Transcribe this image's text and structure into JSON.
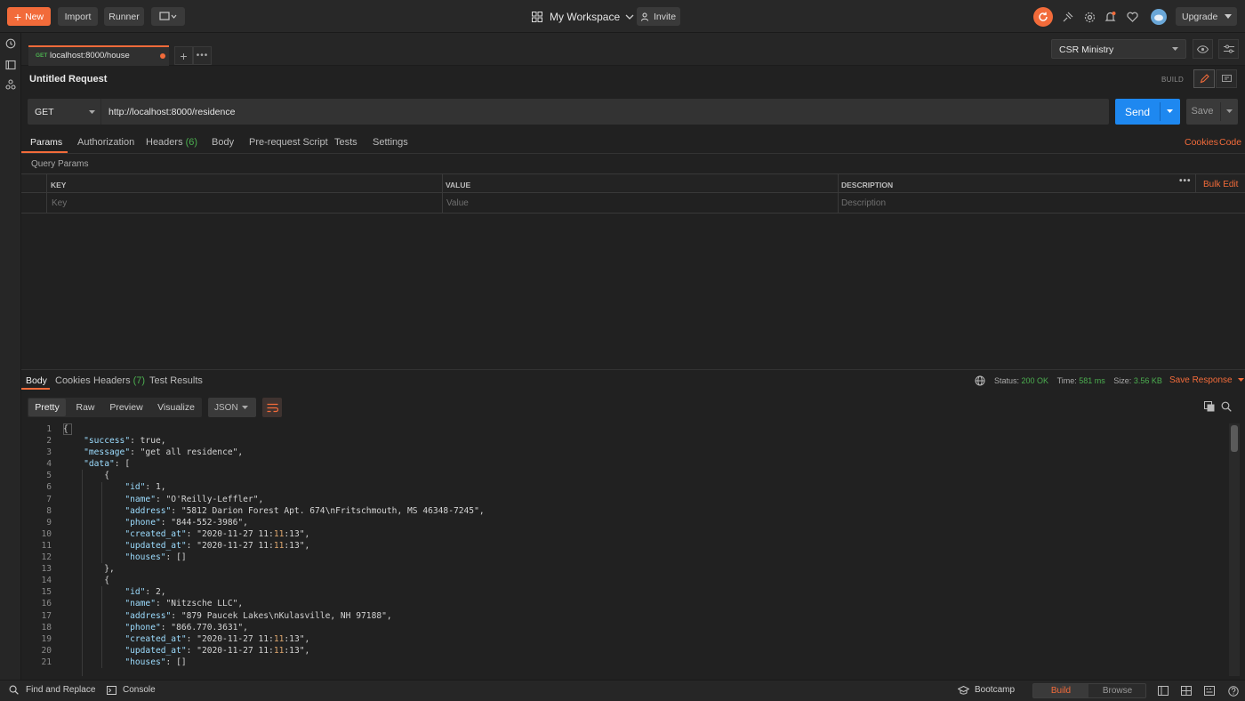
{
  "topbar": {
    "new_label": "New",
    "import_label": "Import",
    "runner_label": "Runner",
    "workspace_label": "My Workspace",
    "invite_label": "Invite",
    "upgrade_label": "Upgrade"
  },
  "tabs": {
    "active_method": "GET",
    "active_title": "localhost:8000/house"
  },
  "environment": {
    "selected": "CSR Ministry"
  },
  "request": {
    "name": "Untitled Request",
    "build_label": "BUILD",
    "method": "GET",
    "url": "http://localhost:8000/residence",
    "send_label": "Send",
    "save_label": "Save"
  },
  "request_tabs": {
    "params": "Params",
    "authorization": "Authorization",
    "headers": "Headers",
    "headers_count": "(6)",
    "body": "Body",
    "prerequest": "Pre-request Script",
    "tests": "Tests",
    "settings": "Settings",
    "cookies": "Cookies",
    "code": "Code"
  },
  "params": {
    "section_title": "Query Params",
    "col_key": "KEY",
    "col_value": "VALUE",
    "col_description": "DESCRIPTION",
    "bulk_edit": "Bulk Edit",
    "ph_key": "Key",
    "ph_value": "Value",
    "ph_description": "Description"
  },
  "response_tabs": {
    "body": "Body",
    "cookies": "Cookies",
    "headers": "Headers",
    "headers_count": "(7)",
    "test_results": "Test Results"
  },
  "response_status": {
    "status_label": "Status:",
    "status_value": "200 OK",
    "time_label": "Time:",
    "time_value": "581 ms",
    "size_label": "Size:",
    "size_value": "3.56 KB",
    "save_response": "Save Response"
  },
  "view_modes": {
    "pretty": "Pretty",
    "raw": "Raw",
    "preview": "Preview",
    "visualize": "Visualize",
    "format": "JSON"
  },
  "response_lines": [
    "{",
    "    \"success\": true,",
    "    \"message\": \"get all residence\",",
    "    \"data\": [",
    "        {",
    "            \"id\": 1,",
    "            \"name\": \"O'Reilly-Leffler\",",
    "            \"address\": \"5812 Darion Forest Apt. 674\\nFritschmouth, MS 46348-7245\",",
    "            \"phone\": \"844-552-3986\",",
    "            \"created_at\": \"2020-11-27 11:11:13\",",
    "            \"updated_at\": \"2020-11-27 11:11:13\",",
    "            \"houses\": []",
    "        },",
    "        {",
    "            \"id\": 2,",
    "            \"name\": \"Nitzsche LLC\",",
    "            \"address\": \"879 Paucek Lakes\\nKulasville, NH 97188\",",
    "            \"phone\": \"866.770.3631\",",
    "            \"created_at\": \"2020-11-27 11:11:13\",",
    "            \"updated_at\": \"2020-11-27 11:11:13\",",
    "            \"houses\": []"
  ],
  "bottombar": {
    "find_replace": "Find and Replace",
    "console": "Console",
    "bootcamp": "Bootcamp",
    "build": "Build",
    "browse": "Browse"
  }
}
